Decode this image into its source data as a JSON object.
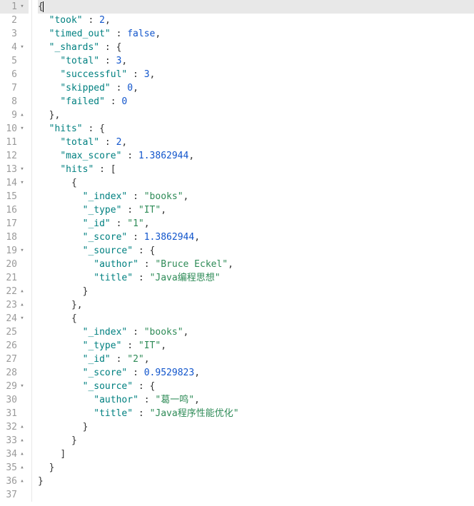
{
  "lines": [
    {
      "num": "1",
      "fold": "▾",
      "hl": true,
      "indent": 0,
      "tokens": [
        {
          "t": "{",
          "c": "k-punc"
        },
        {
          "t": "|",
          "c": "cursor"
        }
      ]
    },
    {
      "num": "2",
      "fold": "",
      "hl": false,
      "indent": 1,
      "tokens": [
        {
          "t": "\"took\"",
          "c": "k-key"
        },
        {
          "t": " : ",
          "c": "k-punc"
        },
        {
          "t": "2",
          "c": "k-num"
        },
        {
          "t": ",",
          "c": "k-punc"
        }
      ]
    },
    {
      "num": "3",
      "fold": "",
      "hl": false,
      "indent": 1,
      "tokens": [
        {
          "t": "\"timed_out\"",
          "c": "k-key"
        },
        {
          "t": " : ",
          "c": "k-punc"
        },
        {
          "t": "false",
          "c": "k-bool"
        },
        {
          "t": ",",
          "c": "k-punc"
        }
      ]
    },
    {
      "num": "4",
      "fold": "▾",
      "hl": false,
      "indent": 1,
      "tokens": [
        {
          "t": "\"_shards\"",
          "c": "k-key"
        },
        {
          "t": " : {",
          "c": "k-punc"
        }
      ]
    },
    {
      "num": "5",
      "fold": "",
      "hl": false,
      "indent": 2,
      "tokens": [
        {
          "t": "\"total\"",
          "c": "k-key"
        },
        {
          "t": " : ",
          "c": "k-punc"
        },
        {
          "t": "3",
          "c": "k-num"
        },
        {
          "t": ",",
          "c": "k-punc"
        }
      ]
    },
    {
      "num": "6",
      "fold": "",
      "hl": false,
      "indent": 2,
      "tokens": [
        {
          "t": "\"successful\"",
          "c": "k-key"
        },
        {
          "t": " : ",
          "c": "k-punc"
        },
        {
          "t": "3",
          "c": "k-num"
        },
        {
          "t": ",",
          "c": "k-punc"
        }
      ]
    },
    {
      "num": "7",
      "fold": "",
      "hl": false,
      "indent": 2,
      "tokens": [
        {
          "t": "\"skipped\"",
          "c": "k-key"
        },
        {
          "t": " : ",
          "c": "k-punc"
        },
        {
          "t": "0",
          "c": "k-num"
        },
        {
          "t": ",",
          "c": "k-punc"
        }
      ]
    },
    {
      "num": "8",
      "fold": "",
      "hl": false,
      "indent": 2,
      "tokens": [
        {
          "t": "\"failed\"",
          "c": "k-key"
        },
        {
          "t": " : ",
          "c": "k-punc"
        },
        {
          "t": "0",
          "c": "k-num"
        }
      ]
    },
    {
      "num": "9",
      "fold": "▴",
      "hl": false,
      "indent": 1,
      "tokens": [
        {
          "t": "},",
          "c": "k-punc"
        }
      ]
    },
    {
      "num": "10",
      "fold": "▾",
      "hl": false,
      "indent": 1,
      "tokens": [
        {
          "t": "\"hits\"",
          "c": "k-key"
        },
        {
          "t": " : {",
          "c": "k-punc"
        }
      ]
    },
    {
      "num": "11",
      "fold": "",
      "hl": false,
      "indent": 2,
      "tokens": [
        {
          "t": "\"total\"",
          "c": "k-key"
        },
        {
          "t": " : ",
          "c": "k-punc"
        },
        {
          "t": "2",
          "c": "k-num"
        },
        {
          "t": ",",
          "c": "k-punc"
        }
      ]
    },
    {
      "num": "12",
      "fold": "",
      "hl": false,
      "indent": 2,
      "tokens": [
        {
          "t": "\"max_score\"",
          "c": "k-key"
        },
        {
          "t": " : ",
          "c": "k-punc"
        },
        {
          "t": "1.3862944",
          "c": "k-num"
        },
        {
          "t": ",",
          "c": "k-punc"
        }
      ]
    },
    {
      "num": "13",
      "fold": "▾",
      "hl": false,
      "indent": 2,
      "tokens": [
        {
          "t": "\"hits\"",
          "c": "k-key"
        },
        {
          "t": " : [",
          "c": "k-punc"
        }
      ]
    },
    {
      "num": "14",
      "fold": "▾",
      "hl": false,
      "indent": 3,
      "tokens": [
        {
          "t": "{",
          "c": "k-punc"
        }
      ]
    },
    {
      "num": "15",
      "fold": "",
      "hl": false,
      "indent": 4,
      "tokens": [
        {
          "t": "\"_index\"",
          "c": "k-key"
        },
        {
          "t": " : ",
          "c": "k-punc"
        },
        {
          "t": "\"books\"",
          "c": "k-str"
        },
        {
          "t": ",",
          "c": "k-punc"
        }
      ]
    },
    {
      "num": "16",
      "fold": "",
      "hl": false,
      "indent": 4,
      "tokens": [
        {
          "t": "\"_type\"",
          "c": "k-key"
        },
        {
          "t": " : ",
          "c": "k-punc"
        },
        {
          "t": "\"IT\"",
          "c": "k-str"
        },
        {
          "t": ",",
          "c": "k-punc"
        }
      ]
    },
    {
      "num": "17",
      "fold": "",
      "hl": false,
      "indent": 4,
      "tokens": [
        {
          "t": "\"_id\"",
          "c": "k-key"
        },
        {
          "t": " : ",
          "c": "k-punc"
        },
        {
          "t": "\"1\"",
          "c": "k-str"
        },
        {
          "t": ",",
          "c": "k-punc"
        }
      ]
    },
    {
      "num": "18",
      "fold": "",
      "hl": false,
      "indent": 4,
      "tokens": [
        {
          "t": "\"_score\"",
          "c": "k-key"
        },
        {
          "t": " : ",
          "c": "k-punc"
        },
        {
          "t": "1.3862944",
          "c": "k-num"
        },
        {
          "t": ",",
          "c": "k-punc"
        }
      ]
    },
    {
      "num": "19",
      "fold": "▾",
      "hl": false,
      "indent": 4,
      "tokens": [
        {
          "t": "\"_source\"",
          "c": "k-key"
        },
        {
          "t": " : {",
          "c": "k-punc"
        }
      ]
    },
    {
      "num": "20",
      "fold": "",
      "hl": false,
      "indent": 5,
      "tokens": [
        {
          "t": "\"author\"",
          "c": "k-key"
        },
        {
          "t": " : ",
          "c": "k-punc"
        },
        {
          "t": "\"Bruce Eckel\"",
          "c": "k-str"
        },
        {
          "t": ",",
          "c": "k-punc"
        }
      ]
    },
    {
      "num": "21",
      "fold": "",
      "hl": false,
      "indent": 5,
      "tokens": [
        {
          "t": "\"title\"",
          "c": "k-key"
        },
        {
          "t": " : ",
          "c": "k-punc"
        },
        {
          "t": "\"Java编程思想\"",
          "c": "k-str"
        }
      ]
    },
    {
      "num": "22",
      "fold": "▴",
      "hl": false,
      "indent": 4,
      "tokens": [
        {
          "t": "}",
          "c": "k-punc"
        }
      ]
    },
    {
      "num": "23",
      "fold": "▴",
      "hl": false,
      "indent": 3,
      "tokens": [
        {
          "t": "},",
          "c": "k-punc"
        }
      ]
    },
    {
      "num": "24",
      "fold": "▾",
      "hl": false,
      "indent": 3,
      "tokens": [
        {
          "t": "{",
          "c": "k-punc"
        }
      ]
    },
    {
      "num": "25",
      "fold": "",
      "hl": false,
      "indent": 4,
      "tokens": [
        {
          "t": "\"_index\"",
          "c": "k-key"
        },
        {
          "t": " : ",
          "c": "k-punc"
        },
        {
          "t": "\"books\"",
          "c": "k-str"
        },
        {
          "t": ",",
          "c": "k-punc"
        }
      ]
    },
    {
      "num": "26",
      "fold": "",
      "hl": false,
      "indent": 4,
      "tokens": [
        {
          "t": "\"_type\"",
          "c": "k-key"
        },
        {
          "t": " : ",
          "c": "k-punc"
        },
        {
          "t": "\"IT\"",
          "c": "k-str"
        },
        {
          "t": ",",
          "c": "k-punc"
        }
      ]
    },
    {
      "num": "27",
      "fold": "",
      "hl": false,
      "indent": 4,
      "tokens": [
        {
          "t": "\"_id\"",
          "c": "k-key"
        },
        {
          "t": " : ",
          "c": "k-punc"
        },
        {
          "t": "\"2\"",
          "c": "k-str"
        },
        {
          "t": ",",
          "c": "k-punc"
        }
      ]
    },
    {
      "num": "28",
      "fold": "",
      "hl": false,
      "indent": 4,
      "tokens": [
        {
          "t": "\"_score\"",
          "c": "k-key"
        },
        {
          "t": " : ",
          "c": "k-punc"
        },
        {
          "t": "0.9529823",
          "c": "k-num"
        },
        {
          "t": ",",
          "c": "k-punc"
        }
      ]
    },
    {
      "num": "29",
      "fold": "▾",
      "hl": false,
      "indent": 4,
      "tokens": [
        {
          "t": "\"_source\"",
          "c": "k-key"
        },
        {
          "t": " : {",
          "c": "k-punc"
        }
      ]
    },
    {
      "num": "30",
      "fold": "",
      "hl": false,
      "indent": 5,
      "tokens": [
        {
          "t": "\"author\"",
          "c": "k-key"
        },
        {
          "t": " : ",
          "c": "k-punc"
        },
        {
          "t": "\"葛一鸣\"",
          "c": "k-str"
        },
        {
          "t": ",",
          "c": "k-punc"
        }
      ]
    },
    {
      "num": "31",
      "fold": "",
      "hl": false,
      "indent": 5,
      "tokens": [
        {
          "t": "\"title\"",
          "c": "k-key"
        },
        {
          "t": " : ",
          "c": "k-punc"
        },
        {
          "t": "\"Java程序性能优化\"",
          "c": "k-str"
        }
      ]
    },
    {
      "num": "32",
      "fold": "▴",
      "hl": false,
      "indent": 4,
      "tokens": [
        {
          "t": "}",
          "c": "k-punc"
        }
      ]
    },
    {
      "num": "33",
      "fold": "▴",
      "hl": false,
      "indent": 3,
      "tokens": [
        {
          "t": "}",
          "c": "k-punc"
        }
      ]
    },
    {
      "num": "34",
      "fold": "▴",
      "hl": false,
      "indent": 2,
      "tokens": [
        {
          "t": "]",
          "c": "k-punc"
        }
      ]
    },
    {
      "num": "35",
      "fold": "▴",
      "hl": false,
      "indent": 1,
      "tokens": [
        {
          "t": "}",
          "c": "k-punc"
        }
      ]
    },
    {
      "num": "36",
      "fold": "▴",
      "hl": false,
      "indent": 0,
      "tokens": [
        {
          "t": "}",
          "c": "k-punc"
        }
      ]
    },
    {
      "num": "37",
      "fold": "",
      "hl": false,
      "indent": 0,
      "tokens": []
    }
  ],
  "indentUnit": "  "
}
